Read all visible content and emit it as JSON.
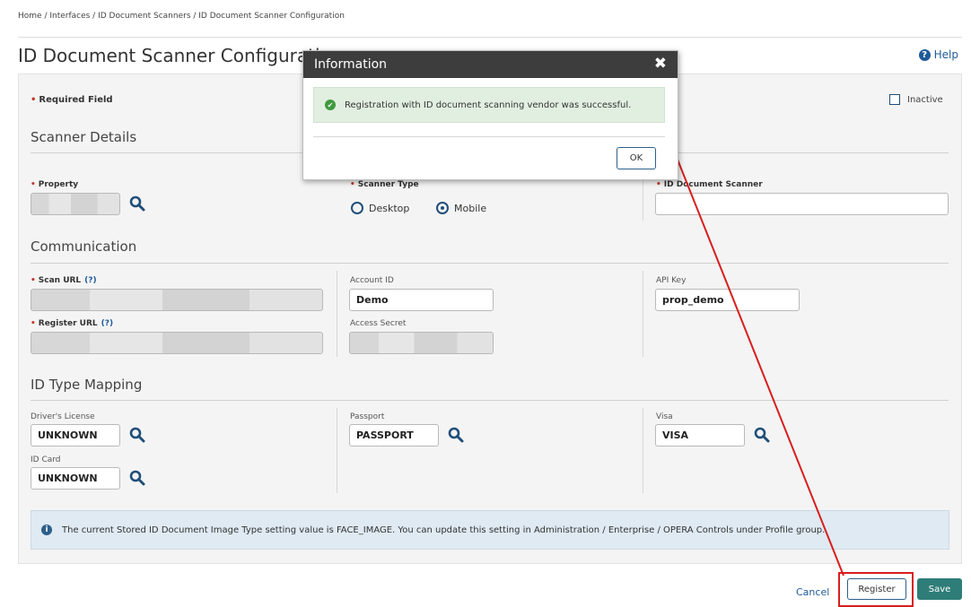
{
  "breadcrumb": "Home / Interfaces / ID Document Scanners / ID Document Scanner Configuration",
  "page_title": "ID Document Scanner Configuration",
  "help_label": "Help",
  "required_label": "Required Field",
  "inactive_label": "Inactive",
  "inactive_checked": false,
  "sections": {
    "scanner": "Scanner Details",
    "communication": "Communication",
    "mapping": "ID Type Mapping"
  },
  "scanner": {
    "property_label": "Property",
    "property_value": "",
    "type_label": "Scanner Type",
    "types": [
      "Desktop",
      "Mobile"
    ],
    "selected_type": "Mobile",
    "device_label": "ID Document Scanner",
    "device_value": ""
  },
  "communication": {
    "scan_url_label": "Scan URL",
    "register_url_label": "Register URL",
    "help_marker": "(?)",
    "account_id_label": "Account ID",
    "account_id_value": "Demo",
    "access_secret_label": "Access Secret",
    "api_key_label": "API Key",
    "api_key_value": "prop_demo"
  },
  "mapping": {
    "drivers_license_label": "Driver's License",
    "drivers_license_value": "UNKNOWN",
    "passport_label": "Passport",
    "passport_value": "PASSPORT",
    "visa_label": "Visa",
    "visa_value": "VISA",
    "id_card_label": "ID Card",
    "id_card_value": "UNKNOWN"
  },
  "info_message": "The current Stored ID Document Image Type setting value is FACE_IMAGE. You can update this setting in Administration / Enterprise / OPERA Controls under Profile group.",
  "buttons": {
    "cancel": "Cancel",
    "register": "Register",
    "save": "Save"
  },
  "dialog": {
    "title": "Information",
    "close_glyph": "✖",
    "message": "Registration with ID document scanning vendor was successful.",
    "ok": "OK"
  },
  "colors": {
    "accent": "#1f5b99",
    "save": "#2e7d78",
    "highlight": "#d81e1e",
    "dialog_header": "#3d3d3d",
    "success_bg": "#e1efe1",
    "info_bg": "#dfeaf3"
  },
  "icons": {
    "search": "search-icon",
    "help": "help-icon",
    "close": "close-icon",
    "success": "check-circle-icon",
    "info": "info-icon"
  }
}
